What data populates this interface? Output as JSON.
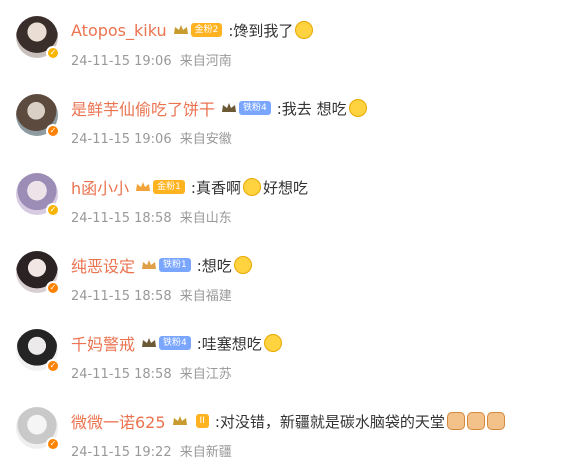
{
  "comments": [
    {
      "username": "Atopos_kiku",
      "fan_badge": "金粉2",
      "fan_badge_color": "#ffb320",
      "text": ":馋到我了",
      "timestamp": "24-11-15 19:06",
      "location": "来自河南",
      "verified_color": "#f7b500",
      "emojis": [
        "smile-emoji"
      ]
    },
    {
      "username": "是鲜芋仙偷吃了饼干",
      "fan_badge": "铁粉4",
      "fan_badge_color": "#7aa6ff",
      "text": ":我去 想吃",
      "timestamp": "24-11-15 19:06",
      "location": "来自安徽",
      "verified_color": "#ff8200",
      "emojis": [
        "smile-emoji"
      ]
    },
    {
      "username": "h函小小",
      "fan_badge": "金粉1",
      "fan_badge_color": "#ffb320",
      "text": ":真香啊",
      "text_after_emoji": "好想吃",
      "timestamp": "24-11-15 18:58",
      "location": "来自山东",
      "verified_color": "#f7b500",
      "emojis": [
        "smile-emoji"
      ]
    },
    {
      "username": "纯恶设定",
      "fan_badge": "铁粉1",
      "fan_badge_color": "#7aa6ff",
      "text": ":想吃",
      "timestamp": "24-11-15 18:58",
      "location": "来自福建",
      "verified_color": "#ff8200",
      "emojis": [
        "heart-eyes-emoji"
      ]
    },
    {
      "username": "千妈警戒",
      "fan_badge": "铁粉4",
      "fan_badge_color": "#7aa6ff",
      "text": ":哇塞想吃",
      "timestamp": "24-11-15 18:58",
      "location": "来自江苏",
      "verified_color": "#ff8200",
      "emojis": [
        "yum-emoji"
      ]
    },
    {
      "username": "微微一诺625",
      "fan_badge": "II",
      "fan_badge_color": "#ffb320",
      "text": ":对没错，新疆就是碳水脑袋的天堂",
      "timestamp": "24-11-15 19:22",
      "location": "来自新疆",
      "verified_color": "#ff8200",
      "emojis": [
        "cat-emoji",
        "cat-emoji",
        "cat-emoji"
      ]
    }
  ]
}
